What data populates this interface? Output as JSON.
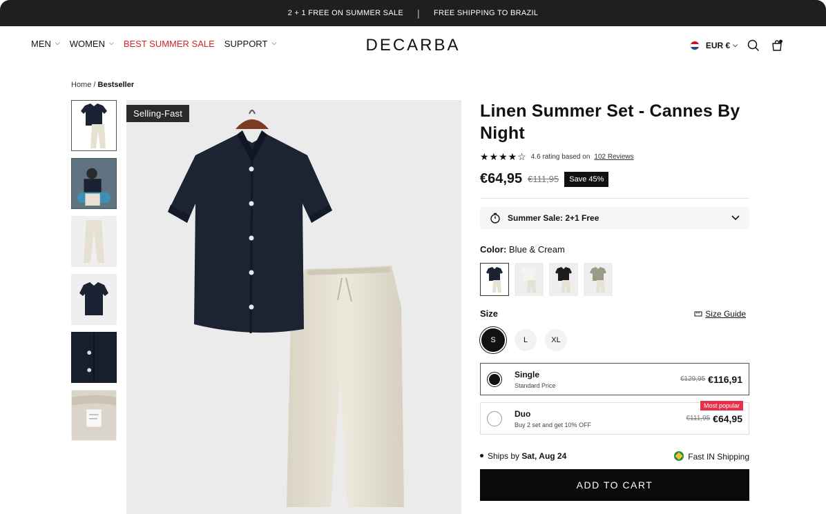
{
  "announcement": {
    "left": "2 + 1  FREE ON SUMMER SALE",
    "separator": "|",
    "right": "FREE SHIPPING TO BRAZIL"
  },
  "nav": {
    "men": "MEN",
    "women": "WOMEN",
    "sale": "BEST SUMMER SALE",
    "support": "SUPPORT",
    "logo": "DECARBA",
    "currency": "EUR €"
  },
  "breadcrumb": {
    "home": "Home",
    "sep": "/",
    "current": "Bestseller"
  },
  "main_image": {
    "badge": "Selling-Fast"
  },
  "product": {
    "title": "Linen Summer Set - Cannes By Night",
    "stars": "★★★★☆",
    "rating_text": "4.6 rating based on",
    "reviews_link": "102 Reviews",
    "price": "€64,95",
    "old_price": "€111,95",
    "save": "Save 45%",
    "accordion": "Summer Sale: 2+1 Free",
    "color_label": "Color:",
    "color_value": "Blue & Cream",
    "size_label": "Size",
    "size_guide": "Size Guide",
    "sizes": [
      "S",
      "L",
      "XL"
    ]
  },
  "options": {
    "single": {
      "name": "Single",
      "sub": "Standard Price",
      "old": "€129,95",
      "new": "€116,91"
    },
    "duo": {
      "name": "Duo",
      "sub": "Buy 2 set and get 10% OFF",
      "old": "€111,95",
      "new": "€64,95",
      "tag": "Most popular"
    }
  },
  "shipping": {
    "ships_by": "Ships by",
    "date": "Sat, Aug 24",
    "fast": "Fast IN Shipping"
  },
  "cta": "ADD TO CART",
  "colors": {
    "accent_sale": "#d2232a",
    "badge_pink": "#e8304a",
    "shirt_navy": "#1a2233",
    "pants_cream": "#e6e1d3"
  }
}
